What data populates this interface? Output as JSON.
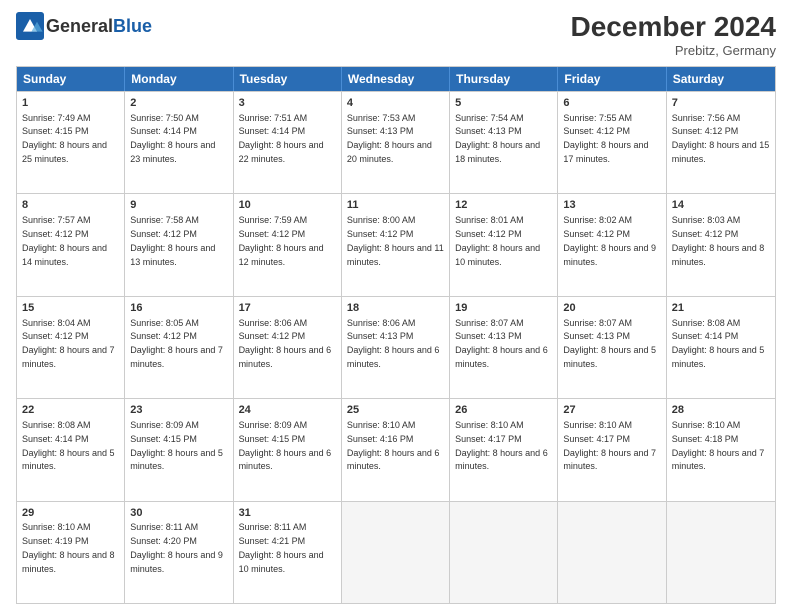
{
  "header": {
    "logo_general": "General",
    "logo_blue": "Blue",
    "month_title": "December 2024",
    "location": "Prebitz, Germany"
  },
  "weekdays": [
    "Sunday",
    "Monday",
    "Tuesday",
    "Wednesday",
    "Thursday",
    "Friday",
    "Saturday"
  ],
  "rows": [
    [
      {
        "day": "1",
        "rise": "Sunrise: 7:49 AM",
        "set": "Sunset: 4:15 PM",
        "daylight": "Daylight: 8 hours and 25 minutes."
      },
      {
        "day": "2",
        "rise": "Sunrise: 7:50 AM",
        "set": "Sunset: 4:14 PM",
        "daylight": "Daylight: 8 hours and 23 minutes."
      },
      {
        "day": "3",
        "rise": "Sunrise: 7:51 AM",
        "set": "Sunset: 4:14 PM",
        "daylight": "Daylight: 8 hours and 22 minutes."
      },
      {
        "day": "4",
        "rise": "Sunrise: 7:53 AM",
        "set": "Sunset: 4:13 PM",
        "daylight": "Daylight: 8 hours and 20 minutes."
      },
      {
        "day": "5",
        "rise": "Sunrise: 7:54 AM",
        "set": "Sunset: 4:13 PM",
        "daylight": "Daylight: 8 hours and 18 minutes."
      },
      {
        "day": "6",
        "rise": "Sunrise: 7:55 AM",
        "set": "Sunset: 4:12 PM",
        "daylight": "Daylight: 8 hours and 17 minutes."
      },
      {
        "day": "7",
        "rise": "Sunrise: 7:56 AM",
        "set": "Sunset: 4:12 PM",
        "daylight": "Daylight: 8 hours and 15 minutes."
      }
    ],
    [
      {
        "day": "8",
        "rise": "Sunrise: 7:57 AM",
        "set": "Sunset: 4:12 PM",
        "daylight": "Daylight: 8 hours and 14 minutes."
      },
      {
        "day": "9",
        "rise": "Sunrise: 7:58 AM",
        "set": "Sunset: 4:12 PM",
        "daylight": "Daylight: 8 hours and 13 minutes."
      },
      {
        "day": "10",
        "rise": "Sunrise: 7:59 AM",
        "set": "Sunset: 4:12 PM",
        "daylight": "Daylight: 8 hours and 12 minutes."
      },
      {
        "day": "11",
        "rise": "Sunrise: 8:00 AM",
        "set": "Sunset: 4:12 PM",
        "daylight": "Daylight: 8 hours and 11 minutes."
      },
      {
        "day": "12",
        "rise": "Sunrise: 8:01 AM",
        "set": "Sunset: 4:12 PM",
        "daylight": "Daylight: 8 hours and 10 minutes."
      },
      {
        "day": "13",
        "rise": "Sunrise: 8:02 AM",
        "set": "Sunset: 4:12 PM",
        "daylight": "Daylight: 8 hours and 9 minutes."
      },
      {
        "day": "14",
        "rise": "Sunrise: 8:03 AM",
        "set": "Sunset: 4:12 PM",
        "daylight": "Daylight: 8 hours and 8 minutes."
      }
    ],
    [
      {
        "day": "15",
        "rise": "Sunrise: 8:04 AM",
        "set": "Sunset: 4:12 PM",
        "daylight": "Daylight: 8 hours and 7 minutes."
      },
      {
        "day": "16",
        "rise": "Sunrise: 8:05 AM",
        "set": "Sunset: 4:12 PM",
        "daylight": "Daylight: 8 hours and 7 minutes."
      },
      {
        "day": "17",
        "rise": "Sunrise: 8:06 AM",
        "set": "Sunset: 4:12 PM",
        "daylight": "Daylight: 8 hours and 6 minutes."
      },
      {
        "day": "18",
        "rise": "Sunrise: 8:06 AM",
        "set": "Sunset: 4:13 PM",
        "daylight": "Daylight: 8 hours and 6 minutes."
      },
      {
        "day": "19",
        "rise": "Sunrise: 8:07 AM",
        "set": "Sunset: 4:13 PM",
        "daylight": "Daylight: 8 hours and 6 minutes."
      },
      {
        "day": "20",
        "rise": "Sunrise: 8:07 AM",
        "set": "Sunset: 4:13 PM",
        "daylight": "Daylight: 8 hours and 5 minutes."
      },
      {
        "day": "21",
        "rise": "Sunrise: 8:08 AM",
        "set": "Sunset: 4:14 PM",
        "daylight": "Daylight: 8 hours and 5 minutes."
      }
    ],
    [
      {
        "day": "22",
        "rise": "Sunrise: 8:08 AM",
        "set": "Sunset: 4:14 PM",
        "daylight": "Daylight: 8 hours and 5 minutes."
      },
      {
        "day": "23",
        "rise": "Sunrise: 8:09 AM",
        "set": "Sunset: 4:15 PM",
        "daylight": "Daylight: 8 hours and 5 minutes."
      },
      {
        "day": "24",
        "rise": "Sunrise: 8:09 AM",
        "set": "Sunset: 4:15 PM",
        "daylight": "Daylight: 8 hours and 6 minutes."
      },
      {
        "day": "25",
        "rise": "Sunrise: 8:10 AM",
        "set": "Sunset: 4:16 PM",
        "daylight": "Daylight: 8 hours and 6 minutes."
      },
      {
        "day": "26",
        "rise": "Sunrise: 8:10 AM",
        "set": "Sunset: 4:17 PM",
        "daylight": "Daylight: 8 hours and 6 minutes."
      },
      {
        "day": "27",
        "rise": "Sunrise: 8:10 AM",
        "set": "Sunset: 4:17 PM",
        "daylight": "Daylight: 8 hours and 7 minutes."
      },
      {
        "day": "28",
        "rise": "Sunrise: 8:10 AM",
        "set": "Sunset: 4:18 PM",
        "daylight": "Daylight: 8 hours and 7 minutes."
      }
    ],
    [
      {
        "day": "29",
        "rise": "Sunrise: 8:10 AM",
        "set": "Sunset: 4:19 PM",
        "daylight": "Daylight: 8 hours and 8 minutes."
      },
      {
        "day": "30",
        "rise": "Sunrise: 8:11 AM",
        "set": "Sunset: 4:20 PM",
        "daylight": "Daylight: 8 hours and 9 minutes."
      },
      {
        "day": "31",
        "rise": "Sunrise: 8:11 AM",
        "set": "Sunset: 4:21 PM",
        "daylight": "Daylight: 8 hours and 10 minutes."
      },
      null,
      null,
      null,
      null
    ]
  ]
}
